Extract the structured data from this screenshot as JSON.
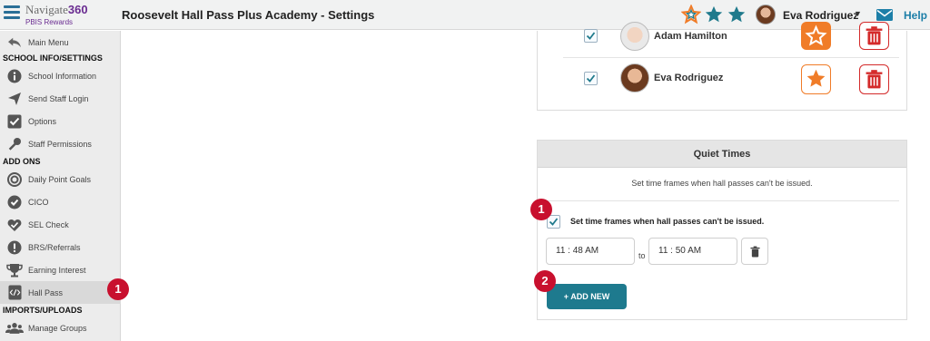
{
  "brand": {
    "name": "Navigate",
    "number": "360",
    "subtitle": "PBIS Rewards"
  },
  "header": {
    "title": "Roosevelt Hall Pass Plus Academy - Settings",
    "user_name": "Eva Rodriguez",
    "help_label": "Help",
    "icons": [
      "hamburger-menu-icon",
      "star-outline-icon",
      "star-icon",
      "star-icon",
      "avatar",
      "mail-icon"
    ]
  },
  "sidebar": {
    "main_menu": "Main Menu",
    "section_school": "SCHOOL INFO/SETTINGS",
    "school_items": [
      {
        "label": "School Information",
        "icon": "info-icon"
      },
      {
        "label": "Send Staff Login",
        "icon": "send-icon"
      },
      {
        "label": "Options",
        "icon": "checkbox-icon"
      },
      {
        "label": "Staff Permissions",
        "icon": "key-icon"
      }
    ],
    "section_addons": "ADD ONS",
    "addon_items": [
      {
        "label": "Daily Point Goals",
        "icon": "target-icon"
      },
      {
        "label": "CICO",
        "icon": "check-circle-icon"
      },
      {
        "label": "SEL Check",
        "icon": "heart-check-icon"
      },
      {
        "label": "BRS/Referrals",
        "icon": "alert-icon"
      },
      {
        "label": "Earning Interest",
        "icon": "trophy-icon"
      },
      {
        "label": "Hall Pass",
        "icon": "hall-pass-icon"
      }
    ],
    "section_imports": "IMPORTS/UPLOADS",
    "import_items": [
      {
        "label": "Manage Groups",
        "icon": "group-icon"
      }
    ]
  },
  "users": [
    {
      "name": "Adam Hamilton",
      "checked": true
    },
    {
      "name": "Eva Rodriguez",
      "checked": true
    }
  ],
  "quiet_times": {
    "title": "Quiet Times",
    "description": "Set time frames when hall passes can't be issued.",
    "checkbox_label": "Set time frames when hall passes can't be issued.",
    "checked": true,
    "start_time": "11 : 48  AM",
    "to_label": "to",
    "end_time": "11 : 50  AM",
    "add_button": "ADD NEW"
  },
  "callouts": [
    "1",
    "1",
    "2"
  ],
  "colors": {
    "accent": "#1e7a8e",
    "orange": "#f07c28",
    "red": "#d42a2a",
    "badge": "#c8102e",
    "teal_star": "#1f7a8c"
  }
}
